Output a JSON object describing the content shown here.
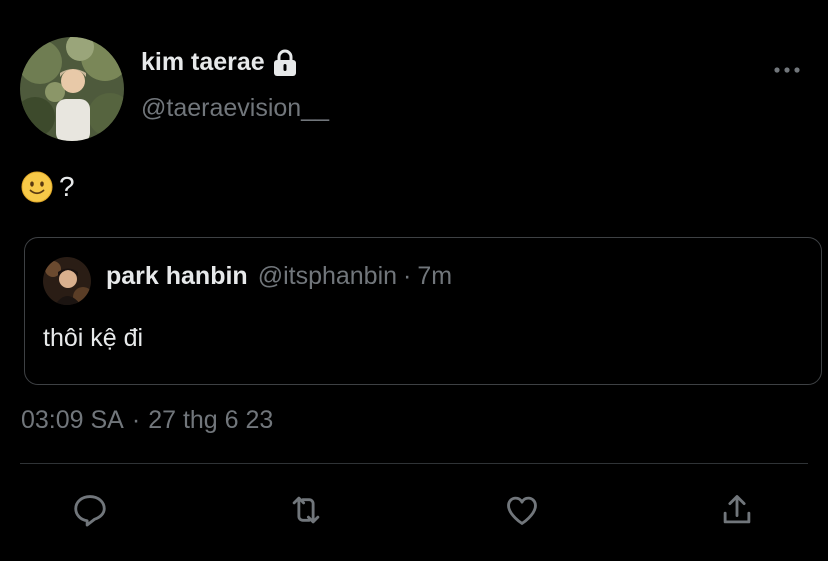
{
  "tweet": {
    "author": {
      "display_name": "kim taerae",
      "handle": "@taeraevision__",
      "protected_icon": "lock-icon"
    },
    "text": "?",
    "emoji": "slightly-smiling-face",
    "quoted": {
      "display_name": "park hanbin",
      "handle": "@itsphanbin",
      "separator": "·",
      "time": "7m",
      "text": "thôi kệ đi"
    },
    "timestamp": {
      "time": "03:09 SA",
      "separator": "·",
      "date": "27 thg 6 23"
    },
    "actions": [
      "reply-icon",
      "retweet-icon",
      "like-icon",
      "share-icon"
    ]
  },
  "colors": {
    "background": "#000000",
    "primary_text": "#e7e9ea",
    "secondary_text": "#71767b",
    "border": "#3e4144"
  }
}
